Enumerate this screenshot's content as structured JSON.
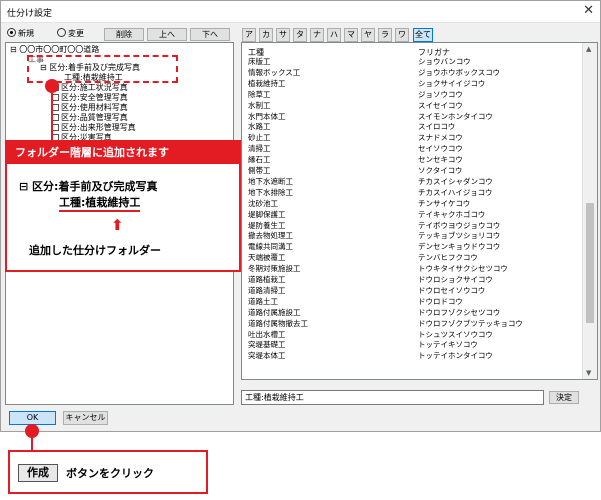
{
  "window": {
    "title": "仕分け設定",
    "close_glyph": "✕"
  },
  "toolbar": {
    "radio_new": "新規",
    "radio_change": "変更",
    "delete_label": "削除",
    "up_label": "上へ",
    "down_label": "下へ"
  },
  "kana_filter": {
    "letters": [
      "ア",
      "カ",
      "サ",
      "タ",
      "ナ",
      "ハ",
      "マ",
      "ヤ",
      "ラ",
      "ワ"
    ],
    "all_label": "全て"
  },
  "tree": {
    "root": "〇〇市〇〇町〇〇道路",
    "sub": "工事",
    "item1": "区分:着手前及び完成写真",
    "item1_child": "工種:植栽維持工",
    "item2": "区分:施工状況写真",
    "item3": "区分:安全管理写真",
    "item4": "区分:使用材料写真",
    "item5": "区分:品質管理写真",
    "item6": "区分:出来形管理写真",
    "item7": "区分:災害写真"
  },
  "list": {
    "col_koshu": "工種",
    "col_furigana": "フリガナ",
    "rows": [
      [
        "床版工",
        "ショウバンコウ"
      ],
      [
        "情報ボックス工",
        "ジョウホウボックスコウ"
      ],
      [
        "植栽維持工",
        "ショクサイイジコウ"
      ],
      [
        "除草工",
        "ジョソウコウ"
      ],
      [
        "水制工",
        "スイセイコウ"
      ],
      [
        "水門本体工",
        "スイモンホンタイコウ"
      ],
      [
        "水路工",
        "スイロコウ"
      ],
      [
        "砂止工",
        "スナドメコウ"
      ],
      [
        "清掃工",
        "セイソウコウ"
      ],
      [
        "縁石工",
        "センセキコウ"
      ],
      [
        "側帯工",
        "ソクタイコウ"
      ],
      [
        "地下水遮断工",
        "チカスイシャダンコウ"
      ],
      [
        "地下水排除工",
        "チカスイハイジョコウ"
      ],
      [
        "沈砂池工",
        "チンサイケコウ"
      ],
      [
        "堤脚保護工",
        "テイキャクホゴコウ"
      ],
      [
        "堤防養生工",
        "テイボウヨウジョウコウ"
      ],
      [
        "撤去物処理工",
        "テッキョブツショリコウ"
      ],
      [
        "電線共同溝工",
        "デンセンキョウドウコウ"
      ],
      [
        "天端被覆工",
        "テンバヒフクコウ"
      ],
      [
        "冬期対策施設工",
        "トウキタイサクシセツコウ"
      ],
      [
        "道路植栽工",
        "ドウロショクサイコウ"
      ],
      [
        "道路清掃工",
        "ドウロセイソウコウ"
      ],
      [
        "道路土工",
        "ドウロドコウ"
      ],
      [
        "道路付属施設工",
        "ドウロフゾクシセツコウ"
      ],
      [
        "道路付属物撤去工",
        "ドウロフゾクブツテッキョコウ"
      ],
      [
        "吐出水槽工",
        "トシュツスイソウコウ"
      ],
      [
        "突堤基礎工",
        "トッテイキソコウ"
      ],
      [
        "突堤本体工",
        "トッテイホンタイコウ"
      ]
    ]
  },
  "input": {
    "value": "工種:植栽維持工",
    "decide_label": "決定"
  },
  "footer": {
    "ok_label": "OK",
    "cancel_label": "キャンセル"
  },
  "callout": {
    "header": "フォルダー階層に追加されます",
    "node1": "区分:着手前及び完成写真",
    "node2": "工種:植栽維持工",
    "caption": "追加した仕分けフォルダー"
  },
  "bottom_note": {
    "tag": "作成",
    "text": "ボタンをクリック"
  },
  "colors": {
    "accent": "#e31b23",
    "selection": "#0078d7"
  }
}
